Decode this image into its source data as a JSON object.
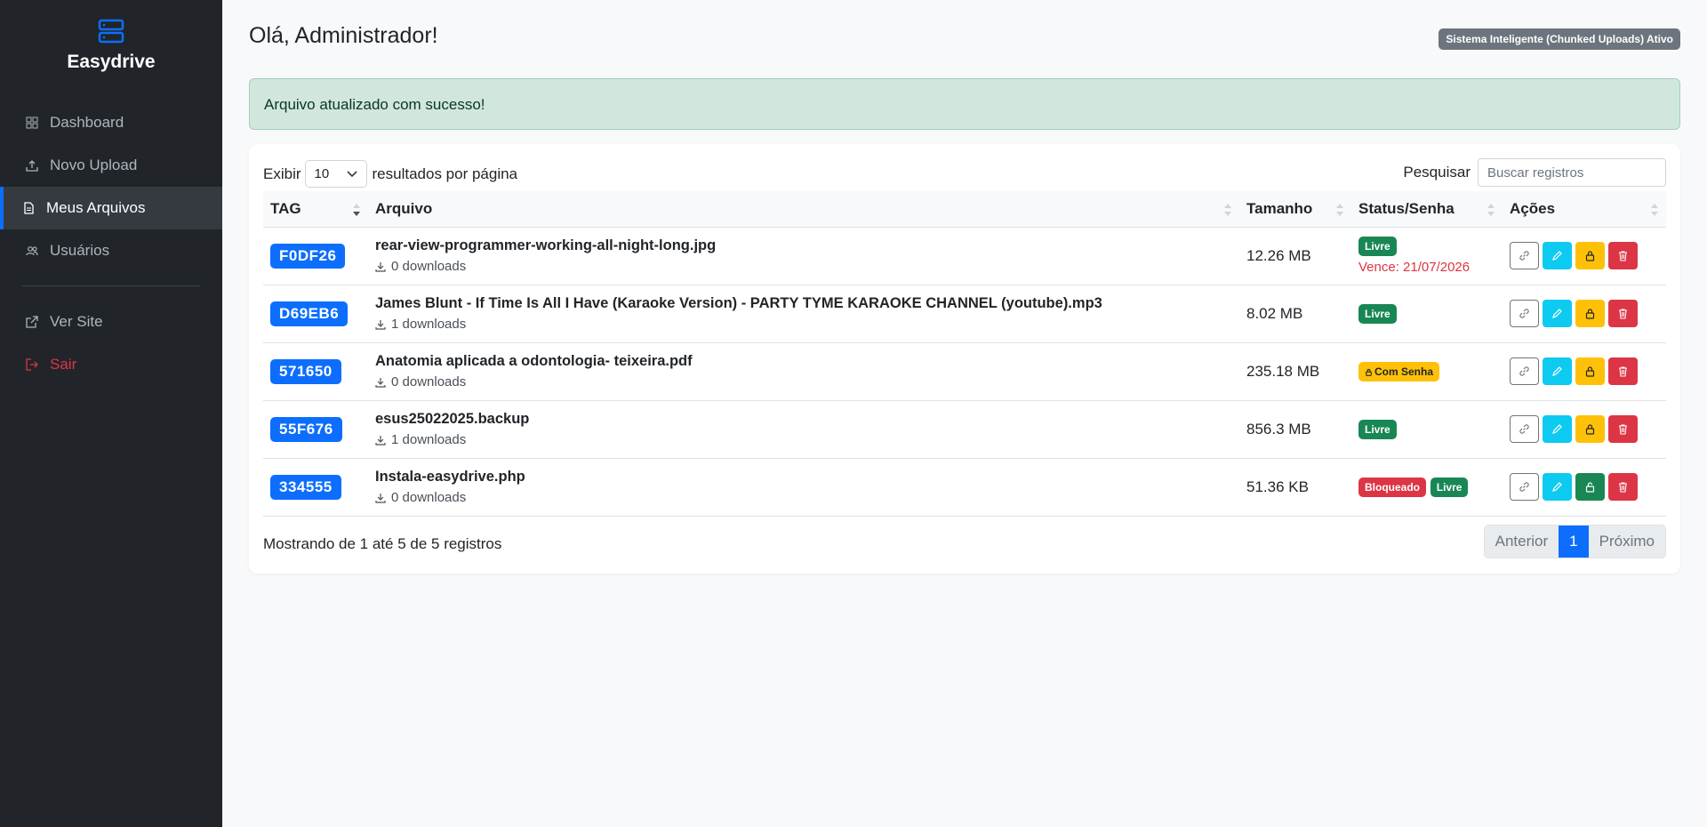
{
  "brand": {
    "name": "Easydrive"
  },
  "sidebar": {
    "items": [
      {
        "label": "Dashboard",
        "icon": "grid-icon"
      },
      {
        "label": "Novo Upload",
        "icon": "upload-icon"
      },
      {
        "label": "Meus Arquivos",
        "icon": "file-icon",
        "active": true
      },
      {
        "label": "Usuários",
        "icon": "users-icon"
      }
    ],
    "bottom_items": [
      {
        "label": "Ver Site",
        "icon": "external-link-icon"
      },
      {
        "label": "Sair",
        "icon": "logout-icon"
      }
    ]
  },
  "header": {
    "greeting": "Olá, Administrador!",
    "system_badge": "Sistema Inteligente (Chunked Uploads) Ativo"
  },
  "alert": {
    "message": "Arquivo atualizado com sucesso!"
  },
  "table_controls": {
    "show_label": "Exibir",
    "page_length": "10",
    "per_page_label": "resultados por página",
    "search_label": "Pesquisar",
    "search_placeholder": "Buscar registros"
  },
  "table": {
    "columns": [
      "TAG",
      "Arquivo",
      "Tamanho",
      "Status/Senha",
      "Ações"
    ],
    "rows": [
      {
        "tag": "F0DF26",
        "name": "rear-view-programmer-working-all-night-long.jpg",
        "downloads": "0 downloads",
        "size": "12.26 MB",
        "status": [
          "Livre"
        ],
        "expire": "Vence: 21/07/2026"
      },
      {
        "tag": "D69EB6",
        "name": "James Blunt - If Time Is All I Have (Karaoke Version) - PARTY TYME KARAOKE CHANNEL (youtube).mp3",
        "downloads": "1 downloads",
        "size": "8.02 MB",
        "status": [
          "Livre"
        ]
      },
      {
        "tag": "571650",
        "name": "Anatomia aplicada a odontologia- teixeira.pdf",
        "downloads": "0 downloads",
        "size": "235.18 MB",
        "status": [
          "Com Senha"
        ]
      },
      {
        "tag": "55F676",
        "name": "esus25022025.backup",
        "downloads": "1 downloads",
        "size": "856.3 MB",
        "status": [
          "Livre"
        ]
      },
      {
        "tag": "334555",
        "name": "Instala-easydrive.php",
        "downloads": "0 downloads",
        "size": "51.36 KB",
        "status": [
          "Bloqueado",
          "Livre"
        ]
      }
    ]
  },
  "footer": {
    "info": "Mostrando de 1 até 5 de 5 registros",
    "prev": "Anterior",
    "page": "1",
    "next": "Próximo"
  },
  "colors": {
    "primary": "#0d6efd",
    "success": "#198754",
    "danger": "#dc3545",
    "warning": "#ffc107",
    "info": "#0dcaf0",
    "sidebar": "#212529"
  }
}
